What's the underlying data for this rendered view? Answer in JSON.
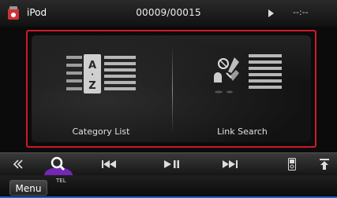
{
  "status": {
    "source": "iPod",
    "track_counter": "00009/00015",
    "time": "--:--"
  },
  "panel": {
    "category_list_label": "Category List",
    "link_search_label": "Link Search"
  },
  "bottom": {
    "menu_label": "Menu",
    "tel_label": "TEL"
  },
  "colors": {
    "highlight_border": "#d0182a",
    "accent_purple": "#8a2bd8",
    "accent_blue": "#1a5fd0"
  },
  "icons": {
    "controls": [
      "double-chevron-left-icon",
      "search-icon",
      "previous-track-icon",
      "play-pause-icon",
      "next-track-icon",
      "ipod-device-icon",
      "eject-icon"
    ]
  }
}
